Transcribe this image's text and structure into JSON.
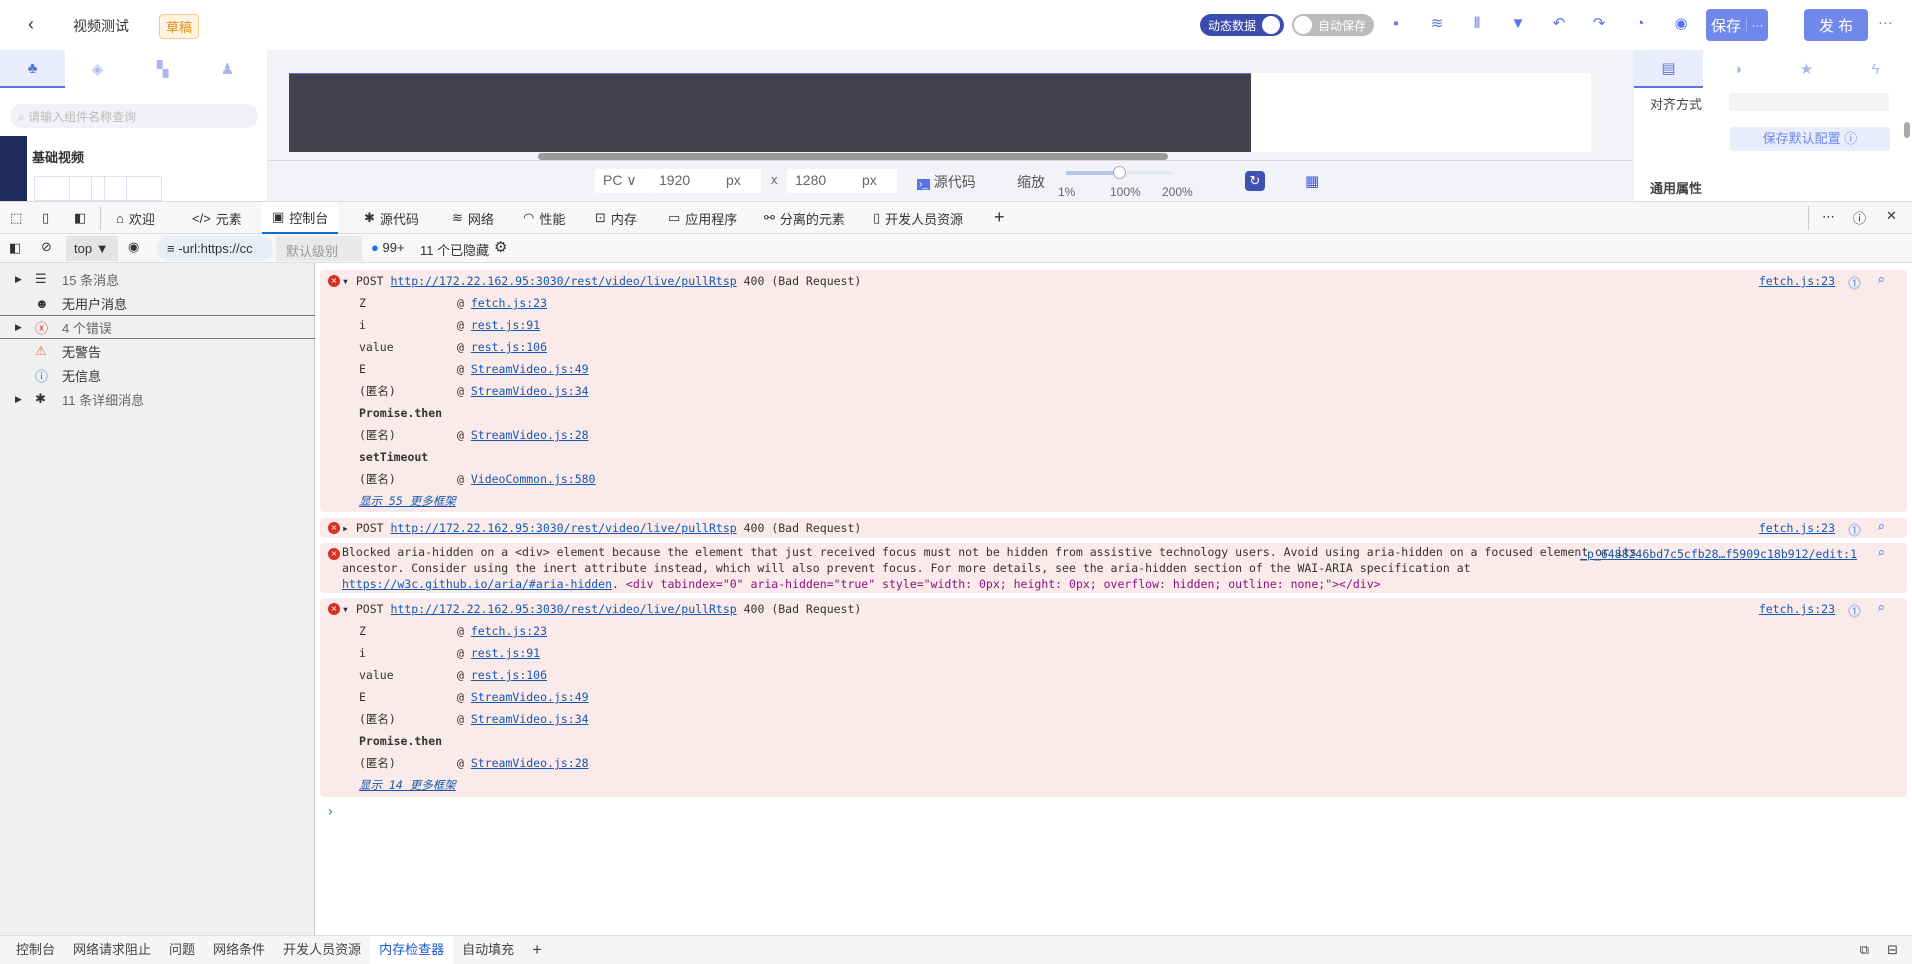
{
  "header": {
    "back": "‹",
    "title": "视频测试",
    "badge": "草稿",
    "toggle_dynamic": "动态数据",
    "toggle_autosave": "自动保存",
    "save": "保存",
    "save_more": "···",
    "publish": "发 布",
    "more": "···"
  },
  "left_panel": {
    "search_placeholder": "请输入组件名称查询",
    "category": "基础视频"
  },
  "canvas_toolbar": {
    "device": "PC",
    "width": "1920",
    "width_unit": "px",
    "times": "x",
    "height": "1280",
    "height_unit": "px",
    "source": "源代码",
    "zoom_label": "缩放",
    "zoom_min": "1%",
    "zoom_mid": "100%",
    "zoom_max": "200%",
    "zoom_value_percent": 100
  },
  "right_panel": {
    "align_label": "对齐方式",
    "save_default": "保存默认配置",
    "general": "通用属性"
  },
  "devtools": {
    "tabs": [
      "欢迎",
      "元素",
      "控制台",
      "源代码",
      "网络",
      "性能",
      "内存",
      "应用程序",
      "分离的元素",
      "开发人员资源"
    ],
    "active_tab": "控制台"
  },
  "console_toolbar": {
    "context": "top",
    "filter": "-url:https://cc",
    "level": "默认级别",
    "issues": "99+",
    "hidden": "11 个已隐藏"
  },
  "sidebar": [
    {
      "label": "15 条消息",
      "icon": "list-icon"
    },
    {
      "label": "无用户消息",
      "icon": "user-icon"
    },
    {
      "label": "4 个错误",
      "icon": "error-icon"
    },
    {
      "label": "无警告",
      "icon": "warning-icon"
    },
    {
      "label": "无信息",
      "icon": "info-icon"
    },
    {
      "label": "11 条详细消息",
      "icon": "bug-icon"
    }
  ],
  "messages": {
    "m1": {
      "method": "POST",
      "url": "http://172.22.162.95:3030/rest/video/live/pullRtsp",
      "status": "400 (Bad Request)",
      "source": "fetch.js:23",
      "stack": [
        [
          "Z",
          "fetch.js:23"
        ],
        [
          "i",
          "rest.js:91"
        ],
        [
          "value",
          "rest.js:106"
        ],
        [
          "E",
          "StreamVideo.js:49"
        ],
        [
          "(匿名)",
          "StreamVideo.js:34"
        ],
        [
          "Promise.then",
          ""
        ],
        [
          "(匿名)",
          "StreamVideo.js:28"
        ],
        [
          "setTimeout",
          ""
        ],
        [
          "(匿名)",
          "VideoCommon.js:580"
        ]
      ],
      "more": "显示 55 更多框架"
    },
    "m2": {
      "method": "POST",
      "url": "http://172.22.162.95:3030/rest/video/live/pullRtsp",
      "status": "400 (Bad Request)",
      "source": "fetch.js:23"
    },
    "m3": {
      "text1": "Blocked aria-hidden on a <div> element because the element that just received focus must not be hidden from assistive technology users. Avoid using aria-hidden on a focused element or its",
      "text2": "ancestor. Consider using the inert attribute instead, which will also prevent focus. For more details, see the aria-hidden section of the WAI-ARIA specification at",
      "link": "https://w3c.github.io/aria/#aria-hidden",
      "after": ".",
      "node": "<div tabindex=\"0\" aria-hidden=\"true\" style=\"width: 0px; height: 0px; overflow: hidden; outline: none;\"></div>",
      "source": "_p_6488246bd7c5cfb28…f5909c18b912/edit:1"
    },
    "m4": {
      "method": "POST",
      "url": "http://172.22.162.95:3030/rest/video/live/pullRtsp",
      "status": "400 (Bad Request)",
      "source": "fetch.js:23",
      "stack": [
        [
          "Z",
          "fetch.js:23"
        ],
        [
          "i",
          "rest.js:91"
        ],
        [
          "value",
          "rest.js:106"
        ],
        [
          "E",
          "StreamVideo.js:49"
        ],
        [
          "(匿名)",
          "StreamVideo.js:34"
        ],
        [
          "Promise.then",
          ""
        ],
        [
          "(匿名)",
          "StreamVideo.js:28"
        ]
      ],
      "more": "显示 14 更多框架"
    }
  },
  "prompt": "›",
  "drawer_tabs": [
    "控制台",
    "网络请求阻止",
    "问题",
    "网络条件",
    "开发人员资源",
    "内存检查器",
    "自动填充"
  ],
  "drawer_active": "内存检查器",
  "colors": {
    "accent": "#7088ec",
    "error_bg": "#fbeaea",
    "error": "#d93025",
    "link": "#1558b0"
  }
}
